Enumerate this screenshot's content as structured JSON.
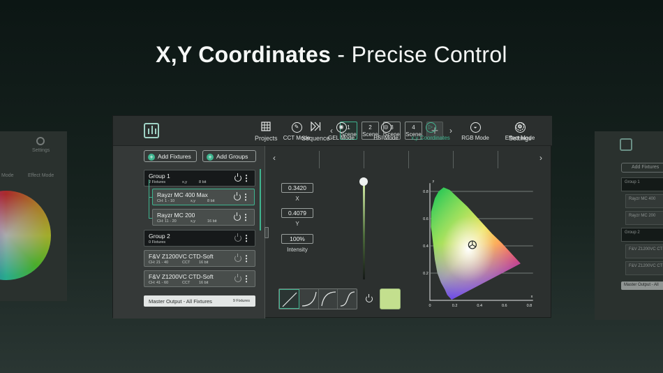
{
  "headline": {
    "bold": "X,Y Coordinates",
    "rest": " - Precise Control"
  },
  "colors": {
    "accent": "#3fb48f",
    "swatch": "#c3df8e",
    "background": "#17231f"
  },
  "topbar": {
    "projects_label": "Projects",
    "sequence_label": "Sequence",
    "settings_label": "Settings",
    "scenes": [
      {
        "number": "1",
        "label": "Scene",
        "active": true
      },
      {
        "number": "2",
        "label": "Scene",
        "active": false
      },
      {
        "number": "3",
        "label": "Scene",
        "active": false
      },
      {
        "number": "4",
        "label": "Scene",
        "active": false
      }
    ],
    "add_scene": "+",
    "prev": "‹",
    "next": "›"
  },
  "fixtures_panel": {
    "add_fixtures": "Add Fixtures",
    "add_groups": "Add Groups",
    "rows": [
      {
        "title": "Group 1",
        "sub": "2 Fixtures",
        "mode": "x,y",
        "bits": "8 bit"
      },
      {
        "title": "Rayzr MC 400 Max",
        "sub": "CH: 1 - 10",
        "mode": "x,y",
        "bits": "8 bit"
      },
      {
        "title": "Rayzr MC 200",
        "sub": "CH: 11 - 20",
        "mode": "x,y",
        "bits": "16 bit"
      },
      {
        "title": "Group 2",
        "sub": "0 Fixtures",
        "mode": "",
        "bits": ""
      },
      {
        "title": "F&V Z1200VC CTD-Soft",
        "sub": "CH: 21 - 40",
        "mode": "CCT",
        "bits": "16 bit"
      },
      {
        "title": "F&V Z1200VC CTD-Soft",
        "sub": "CH: 41 - 60",
        "mode": "CCT",
        "bits": "16 bit"
      }
    ],
    "master_output": "Master Output - All Fixtures",
    "master_count": "9 Fixtures"
  },
  "modes": [
    {
      "label": "CCT Mode",
      "icon": "cct-icon",
      "active": false
    },
    {
      "label": "GEL Mode",
      "icon": "gel-icon",
      "active": false
    },
    {
      "label": "HSI Mode",
      "icon": "hsi-icon",
      "active": false
    },
    {
      "label": "x,y Coordinates",
      "icon": "xy-icon",
      "active": true
    },
    {
      "label": "RGB Mode",
      "icon": "rgb-icon",
      "active": false
    },
    {
      "label": "Effect Mode",
      "icon": "effect-icon",
      "active": false
    }
  ],
  "controls": {
    "x_value": "0.3420",
    "x_label": "X",
    "y_value": "0.4079",
    "y_label": "Y",
    "intensity_value": "100%",
    "intensity_label": "Intensity",
    "intensity_level": 1.0
  },
  "cie": {
    "y_axis": "y",
    "x_axis": "x",
    "y_ticks": [
      "0.8",
      "0.6",
      "0.4",
      "0.2"
    ],
    "x_ticks": [
      "0",
      "0.2",
      "0.4",
      "0.6",
      "0.8"
    ],
    "point": {
      "x": 0.342,
      "y": 0.4079
    }
  },
  "ghost_left": {
    "settings_label": "Settings",
    "mode_label": "Mode",
    "effect_label": "Effect Mode"
  },
  "ghost_right": {
    "add_fixtures": "Add Fixtures",
    "rows": [
      "Group 1",
      "Rayzr MC 400",
      "Rayzr MC 200",
      "Group 2",
      "F&V Z1200VC CTD",
      "F&V Z1200VC CTD"
    ],
    "master": "Master Output - All"
  }
}
